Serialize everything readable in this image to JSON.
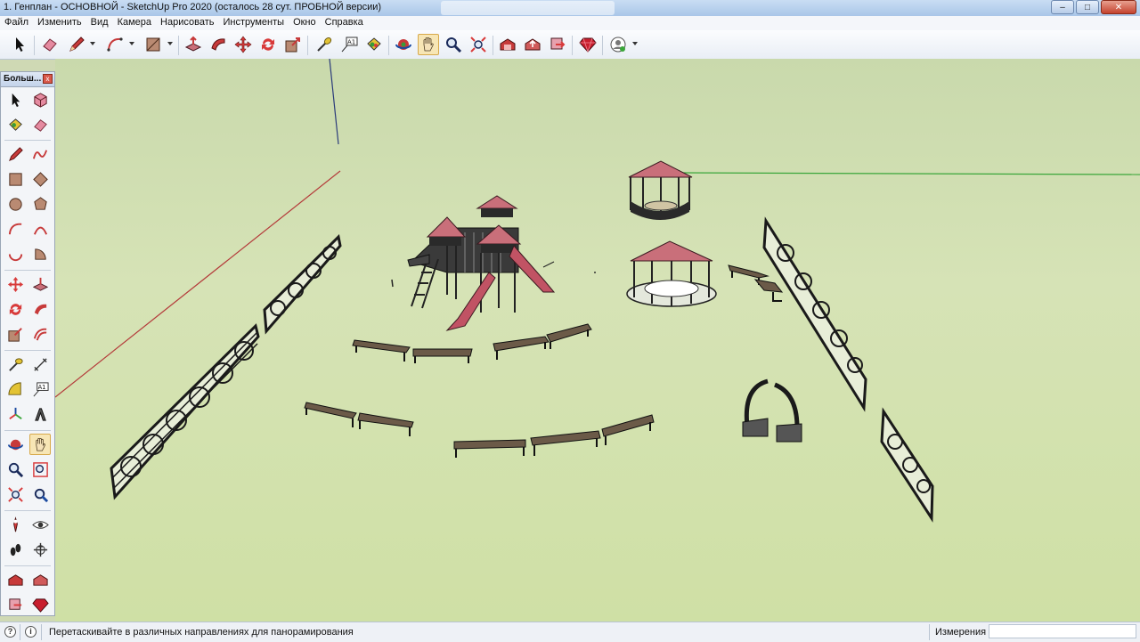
{
  "window": {
    "title": "1. Генплан - ОСНОВНОЙ - SketchUp Pro 2020 (осталось 28 сут. ПРОБНОЙ версии)",
    "minimize": "–",
    "maximize": "□",
    "close": "✕"
  },
  "menu": [
    "Файл",
    "Изменить",
    "Вид",
    "Камера",
    "Нарисовать",
    "Инструменты",
    "Окно",
    "Справка"
  ],
  "toolbar": {
    "tools": [
      {
        "name": "select-tool",
        "icon": "arrow-cursor-icon"
      },
      {
        "name": "eraser-tool",
        "icon": "eraser-icon"
      },
      {
        "name": "pencil-tool",
        "icon": "pencil-icon",
        "dropdown": true
      },
      {
        "name": "arc-tool",
        "icon": "arc-icon",
        "dropdown": true
      },
      {
        "name": "rectangle-tool",
        "icon": "rectangle-icon",
        "dropdown": true
      },
      {
        "name": "push-pull-tool",
        "icon": "push-pull-icon"
      },
      {
        "name": "follow-me-tool",
        "icon": "follow-me-icon"
      },
      {
        "name": "move-tool",
        "icon": "move-icon"
      },
      {
        "name": "rotate-tool",
        "icon": "rotate-icon"
      },
      {
        "name": "scale-tool",
        "icon": "scale-icon"
      },
      {
        "name": "tape-measure-tool",
        "icon": "tape-measure-icon"
      },
      {
        "name": "text-tool",
        "icon": "text-icon",
        "label": "A1"
      },
      {
        "name": "paint-bucket-tool",
        "icon": "paint-bucket-icon"
      },
      {
        "name": "orbit-tool",
        "icon": "orbit-icon"
      },
      {
        "name": "pan-tool",
        "icon": "hand-icon",
        "active": true
      },
      {
        "name": "zoom-tool",
        "icon": "zoom-icon"
      },
      {
        "name": "zoom-extents-tool",
        "icon": "zoom-extents-icon"
      },
      {
        "name": "warehouse-tool",
        "icon": "warehouse-icon"
      },
      {
        "name": "share-model-tool",
        "icon": "share-model-icon"
      },
      {
        "name": "extension-warehouse-tool",
        "icon": "extension-warehouse-icon"
      },
      {
        "name": "ruby-tool",
        "icon": "ruby-gem-icon"
      },
      {
        "name": "account-tool",
        "icon": "account-icon",
        "dropdown": true
      }
    ]
  },
  "palette": {
    "title": "Больш...",
    "close": "x",
    "text_label": "A1"
  },
  "status": {
    "hint": "Перетаскивайте в различных направлениях для панорамирования",
    "measure_label": "Измерения",
    "measure_value": ""
  },
  "colors": {
    "ground": "#d3e0ae",
    "roof": "#c96f7a",
    "slide": "#c15364",
    "bench_top": "#6b5a48",
    "axis_red": "#b43a3a",
    "axis_green": "#3aa63a",
    "axis_blue": "#2a3a7a",
    "active_tool": "#f7e6b5"
  }
}
